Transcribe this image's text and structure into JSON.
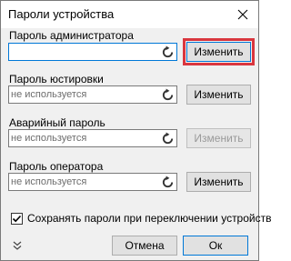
{
  "window": {
    "title": "Пароли устройства"
  },
  "passwords": [
    {
      "label": "Пароль администратора",
      "value": "",
      "change_label": "Изменить",
      "enabled": true,
      "highlighted": true
    },
    {
      "label": "Пароль юстировки",
      "value": "не используется",
      "change_label": "Изменить",
      "enabled": true,
      "highlighted": false
    },
    {
      "label": "Аварийный пароль",
      "value": "не используется",
      "change_label": "Изменить",
      "enabled": false,
      "highlighted": false
    },
    {
      "label": "Пароль оператора",
      "value": "не используется",
      "change_label": "Изменить",
      "enabled": true,
      "highlighted": false
    }
  ],
  "save_option": {
    "label": "Сохранять пароли при переключении устройств",
    "checked": true
  },
  "footer": {
    "cancel_label": "Отмена",
    "ok_label": "Ок"
  },
  "colors": {
    "highlight": "#d9363e",
    "focus": "#0078d7"
  },
  "icons": [
    "close-icon",
    "reset-icon",
    "checkmark-icon",
    "expand-chevrons-icon"
  ]
}
